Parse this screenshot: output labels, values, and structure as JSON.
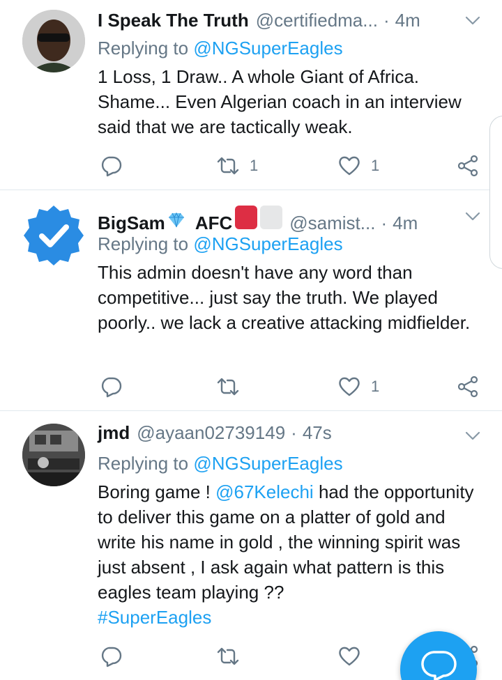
{
  "tweets": [
    {
      "name": "I Speak The Truth",
      "handle": "@certifiedma...",
      "time": "4m",
      "replying_prefix": "Replying to",
      "replying_to": "@NGSuperEagles",
      "text": "1 Loss, 1 Draw.. A whole Giant of Africa. Shame... Even Algerian coach in an interview said that we are tactically weak.",
      "retweets": "1",
      "likes": "1"
    },
    {
      "name": "BigSam",
      "name_suffix": "AFC",
      "handle": "@samist...",
      "time": "4m",
      "replying_prefix": "Replying to",
      "replying_to": "@NGSuperEagles",
      "text": "This admin doesn't have any word than competitive... just say the truth. We played poorly.. we lack a creative attacking midfielder.",
      "retweets": "",
      "likes": "1"
    },
    {
      "name": "jmd",
      "handle": "@ayaan02739149",
      "time": "47s",
      "replying_prefix": "Replying to",
      "replying_to": "@NGSuperEagles",
      "text_pre": "Boring game !",
      "text_mention": "@67Kelechi",
      "text_post": "had the opportunity to deliver this game on a platter of gold and write his name in gold , the winning spirit was just absent , I ask again what pattern is this eagles team playing ??",
      "hashtag": "#SuperEagles",
      "retweets": "",
      "likes": ""
    }
  ],
  "colors": {
    "accent": "#1da1f2",
    "muted": "#657786",
    "text": "#14171a",
    "divider": "#e1e8ed"
  },
  "icons": [
    "reply-icon",
    "retweet-icon",
    "like-icon",
    "share-icon",
    "chevron-down-icon",
    "verified-badge-icon",
    "diamond-emoji",
    "compose-fab"
  ]
}
